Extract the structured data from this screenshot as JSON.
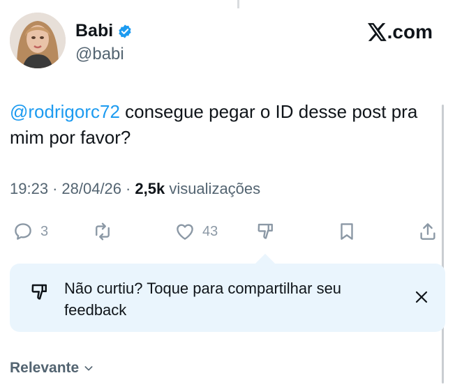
{
  "author": {
    "name": "Babi",
    "handle": "@babi",
    "verified": true
  },
  "brand": {
    "label": ".com"
  },
  "tweet": {
    "mention": "@rodrigorc72",
    "text": " consegue pegar o ID desse post pra mim por favor?"
  },
  "meta": {
    "time": "19:23",
    "sep1": "·",
    "date": "28/04/26",
    "sep2": "·",
    "views_count": "2,5k",
    "views_label": "visualizações"
  },
  "actions": {
    "reply_count": "3",
    "like_count": "43"
  },
  "feedback": {
    "text": "Não curtiu? Toque para compartilhar seu feedback"
  },
  "sort": {
    "label": "Relevante"
  },
  "colors": {
    "accent": "#1d9bf0",
    "text": "#0f1419",
    "muted": "#536471",
    "icon": "#8b98a5",
    "feedback_bg": "#eaf5fd"
  }
}
